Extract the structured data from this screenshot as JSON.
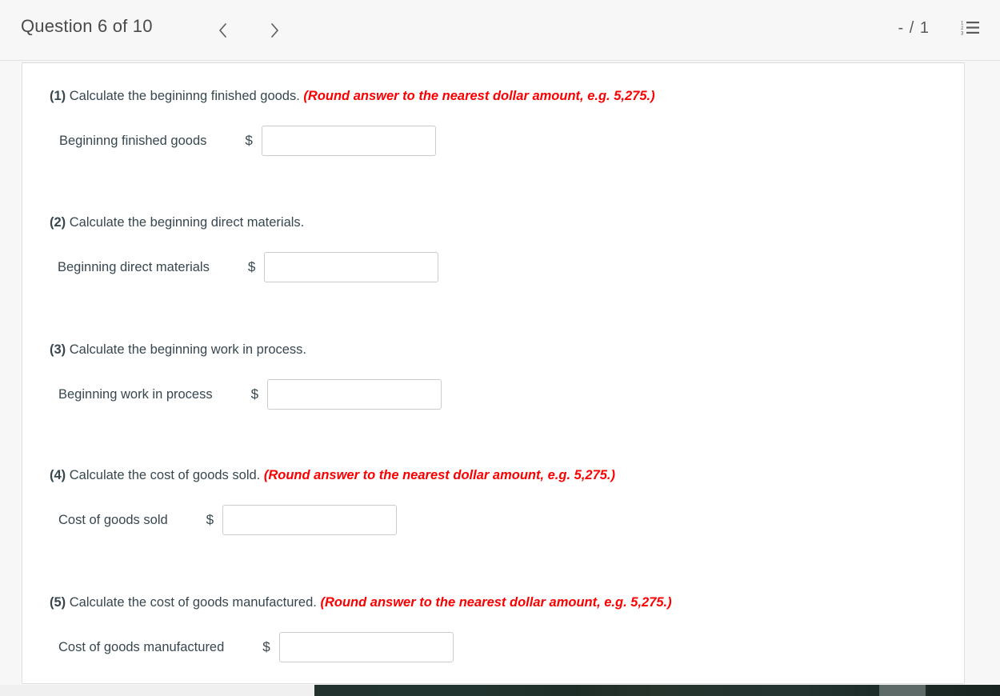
{
  "header": {
    "title": "Question 6 of 10",
    "prev_icon": "chevron-left-icon",
    "next_icon": "chevron-right-icon",
    "score": "- / 1",
    "list_icon": "numbered-list-icon",
    "list_icon_numbers": [
      "1",
      "2",
      "3"
    ]
  },
  "colors": {
    "page_background": "#f7f7f7",
    "card_background": "#ffffff",
    "text": "#37474f",
    "note_red": "#fa0000",
    "input_border": "#cccccc",
    "header_border": "#e2e2e2"
  },
  "questions": [
    {
      "number": "(1)",
      "prompt": "Calculate the begininng finished goods.",
      "note": "(Round answer to the nearest dollar amount, e.g. 5,275.)",
      "label": "Begininng finished goods",
      "currency": "$",
      "value": "",
      "placeholder": ""
    },
    {
      "number": "(2)",
      "prompt": "Calculate the beginning direct materials.",
      "note": "",
      "label": "Beginning direct materials",
      "currency": "$",
      "value": "",
      "placeholder": ""
    },
    {
      "number": "(3)",
      "prompt": "Calculate the beginning work in process.",
      "note": "",
      "label": "Beginning work in process",
      "currency": "$",
      "value": "",
      "placeholder": ""
    },
    {
      "number": "(4)",
      "prompt": "Calculate the cost of goods sold.",
      "note": "(Round answer to the nearest dollar amount, e.g. 5,275.)",
      "label": "Cost of goods sold",
      "currency": "$",
      "value": "",
      "placeholder": ""
    },
    {
      "number": "(5)",
      "prompt": "Calculate the cost of goods manufactured.",
      "note": "(Round answer to the nearest dollar amount, e.g. 5,275.)",
      "label": "Cost of goods manufactured",
      "currency": "$",
      "value": "",
      "placeholder": ""
    }
  ]
}
